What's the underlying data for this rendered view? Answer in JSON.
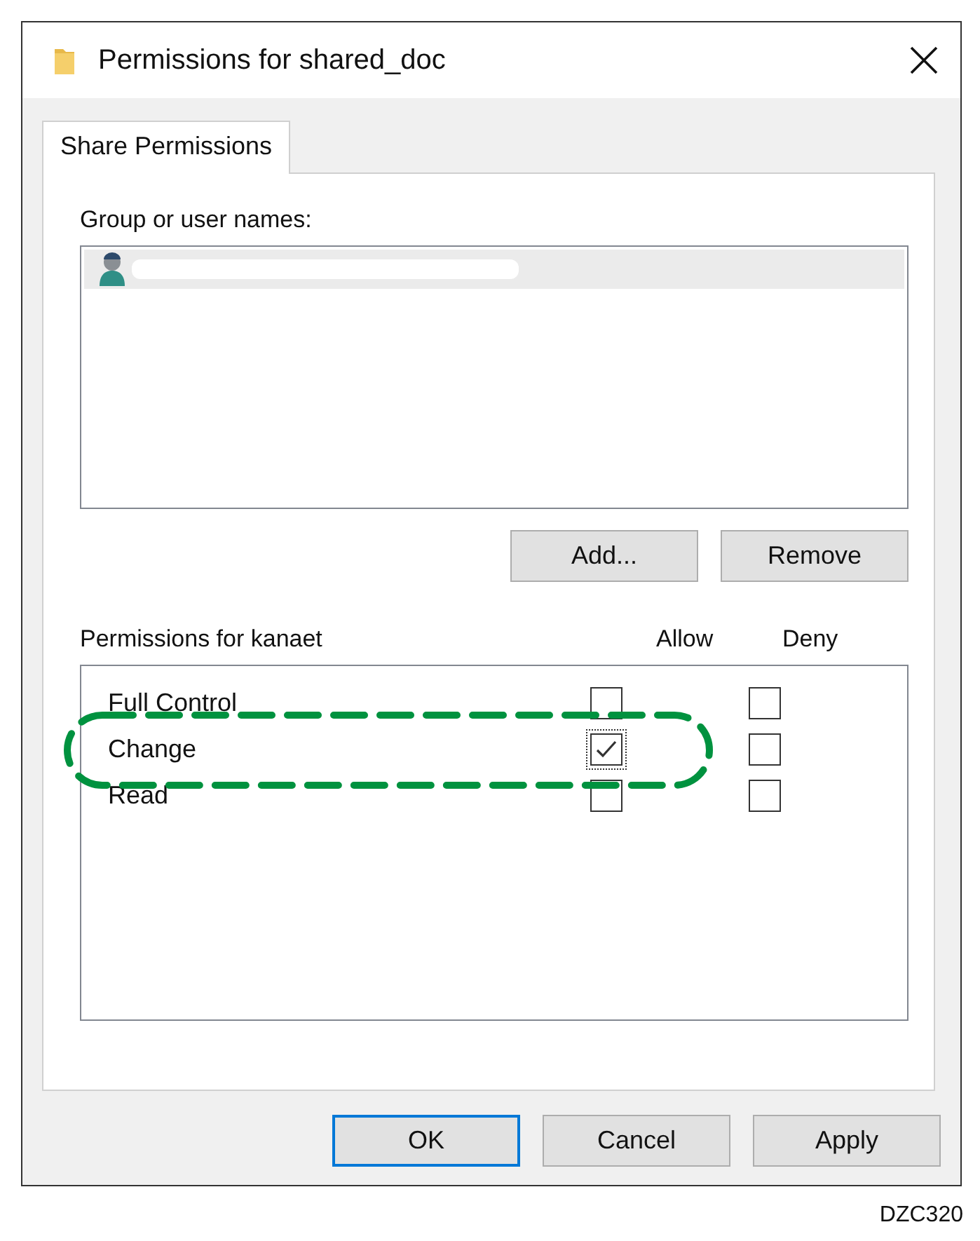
{
  "window": {
    "title": "Permissions for shared_doc"
  },
  "tabs": [
    {
      "label": "Share Permissions",
      "selected": true
    }
  ],
  "group_list": {
    "label": "Group or user names:",
    "items": [
      {
        "kind": "redacted",
        "selected": true
      }
    ]
  },
  "group_buttons": [
    "Add...",
    "Remove"
  ],
  "permissions": {
    "label": "Permissions for kanaet",
    "columns": [
      "Allow",
      "Deny"
    ],
    "rows": [
      {
        "name": "Full Control",
        "allow": false,
        "deny": false
      },
      {
        "name": "Change",
        "allow": true,
        "deny": false,
        "highlighted": true
      },
      {
        "name": "Read",
        "allow": false,
        "deny": false
      }
    ]
  },
  "buttons": [
    {
      "label": "OK",
      "default": true
    },
    {
      "label": "Cancel",
      "default": false
    },
    {
      "label": "Apply",
      "default": false
    }
  ],
  "figure_code": "DZC320"
}
